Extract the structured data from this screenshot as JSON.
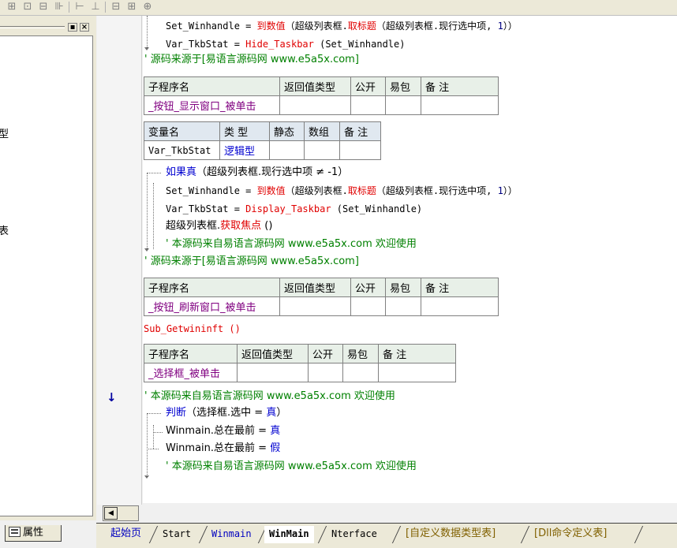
{
  "toolbar": {
    "icons": [
      "grid-icon",
      "layout-icon",
      "tree-icon",
      "columns-icon",
      "align-icon",
      "align2-icon",
      "width-icon",
      "height-icon",
      "center-icon"
    ]
  },
  "left_panel": {
    "fragments": [
      "型",
      "表"
    ],
    "properties_tab": "属性"
  },
  "code": {
    "line1": {
      "ident": "Set_Winhandle",
      "op": " = ",
      "fn": "到数值",
      "p1": "（超级列表框.",
      "fn2": "取标题",
      "p2": "（超级列表框.现行选中项, ",
      "num": "1",
      "p3": "））"
    },
    "line2": {
      "ident": "Var_TkbStat",
      "op": " = ",
      "fn": "Hide_Taskbar",
      "p": " (Set_Winhandle)"
    },
    "comment1": "' 源码来源于[易语言源码网 www.e5a5x.com]",
    "sub1": {
      "headers": [
        "子程序名",
        "返回值类型",
        "公开",
        "易包",
        "备 注"
      ],
      "name": "_按钮_显示窗口_被单击"
    },
    "vars": {
      "headers": [
        "变量名",
        "类 型",
        "静态",
        "数组",
        "备 注"
      ],
      "name": "Var_TkbStat",
      "type": "逻辑型"
    },
    "if_line": {
      "kw": "如果真",
      "cond": "（超级列表框.现行选中项 ≠ -1）"
    },
    "line3": {
      "ident": "Set_Winhandle",
      "op": " = ",
      "fn": "到数值",
      "p1": "（超级列表框.",
      "fn2": "取标题",
      "p2": "（超级列表框.现行选中项, ",
      "num": "1",
      "p3": "））"
    },
    "line4": {
      "ident": "Var_TkbStat",
      "op": " = ",
      "fn": "Display_Taskbar",
      "p": " (Set_Winhandle)"
    },
    "line5": {
      "obj": "超级列表框.",
      "fn": "获取焦点",
      "p": " ()"
    },
    "comment2": "' 本源码来自易语言源码网 www.e5a5x.com  欢迎使用",
    "comment3": "' 源码来源于[易语言源码网 www.e5a5x.com]",
    "sub2": {
      "headers": [
        "子程序名",
        "返回值类型",
        "公开",
        "易包",
        "备 注"
      ],
      "name": "_按钮_刷新窗口_被单击"
    },
    "call1": "Sub_Getwininft ()",
    "sub3": {
      "headers": [
        "子程序名",
        "返回值类型",
        "公开",
        "易包",
        "备 注"
      ],
      "name": "_选择框_被单击"
    },
    "comment4": "' 本源码来自易语言源码网 www.e5a5x.com  欢迎使用",
    "judge": {
      "kw": "判断",
      "cond": "（选择框.选中 = ",
      "val": "真",
      "end": "）"
    },
    "line6": {
      "obj": "Winmain.总在最前",
      "op": " = ",
      "val": "真"
    },
    "line7": {
      "obj": "Winmain.总在最前",
      "op": " = ",
      "val": "假"
    },
    "comment5": "' 本源码来自易语言源码网 www.e5a5x.com  欢迎使用"
  },
  "gutter_marker": "↓",
  "tabs": [
    "起始页",
    "Start",
    "Winmain",
    "WinMain",
    "Nterface",
    "[自定义数据类型表]",
    "[Dll命令定义表]"
  ]
}
